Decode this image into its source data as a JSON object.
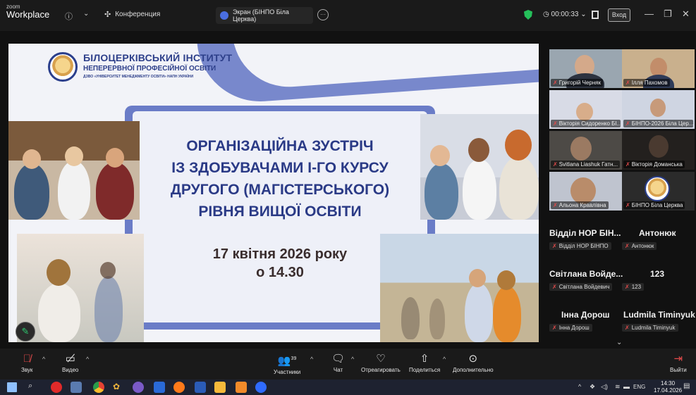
{
  "app": {
    "brand_small": "zoom",
    "brand_main": "Workplace",
    "meeting_title": "Конференция",
    "share_tab_title": "Экран (БІНПО Біла Церква)",
    "timer": "00:00:33",
    "enter_label": "Вход"
  },
  "slide": {
    "institute_line1": "БІЛОЦЕРКІВСЬКИЙ ІНСТИТУТ",
    "institute_line2": "НЕПЕРЕРВНОЇ ПРОФЕСІЙНОЇ ОСВІТИ",
    "institute_line3": "ДЗВО «УНІВЕРСИТЕТ МЕНЕДЖМЕНТУ ОСВІТИ» НАПН УКРАЇНИ",
    "headline": [
      "ОРГАНІЗАЦІЙНА ЗУСТРІЧ",
      "ІЗ ЗДОБУВАЧАМИ І-ГО КУРСУ",
      "ДРУГОГО (МАГІСТЕРСЬКОГО)",
      "РІВНЯ ВИЩОЇ ОСВІТИ"
    ],
    "date": "17 квітня 2026 року",
    "time": "о 14.30"
  },
  "video_tiles": [
    {
      "label": "Григорій Черняк",
      "bg": "#9aa6b0"
    },
    {
      "label": "Ілля Пахомов",
      "bg": "#c9b08d"
    },
    {
      "label": "Вікторія Сидоренко БІ...",
      "bg": "#d8dbe6"
    },
    {
      "label": "БІНПО-2026 Біла Цер...",
      "bg": "#cfd5e2"
    },
    {
      "label": "Svitlana Liashuk  Гатн...",
      "bg": "#4d4a46"
    },
    {
      "label": "Вікторія Доманська",
      "bg": "#23201e"
    },
    {
      "label": "Альона Кравлівна",
      "bg": "#bfc4cf"
    },
    {
      "label": "БІНПО Біла Церква",
      "bg": "#2b2b2b"
    }
  ],
  "name_tiles": [
    {
      "big": "Відділ НОР БІН...",
      "cap": "Відділ НОР БІНПО"
    },
    {
      "big": "Антонюк",
      "cap": "Антонюк"
    },
    {
      "big": "Світлана Войде...",
      "cap": "Світлана Войдевич"
    },
    {
      "big": "123",
      "cap": "123"
    },
    {
      "big": "Інна Дорош",
      "cap": "Інна Дорош"
    },
    {
      "big": "Ludmila Timinyuk",
      "cap": "Ludmila Timinyuk"
    }
  ],
  "controls": {
    "audio": "Звук",
    "video": "Видео",
    "participants": "Участники",
    "participants_count": "39",
    "chat": "Чат",
    "react": "Отреагировать",
    "share": "Поделиться",
    "more": "Дополнительно",
    "leave": "Выйти"
  },
  "taskbar": {
    "lang": "ENG",
    "time": "14:30",
    "date": "17.04.2026"
  },
  "colors": {
    "accent_green": "#2fd158",
    "slide_blue": "#6a7cc7",
    "headline_blue": "#2a3a86",
    "mic_red": "#e24a4a"
  }
}
